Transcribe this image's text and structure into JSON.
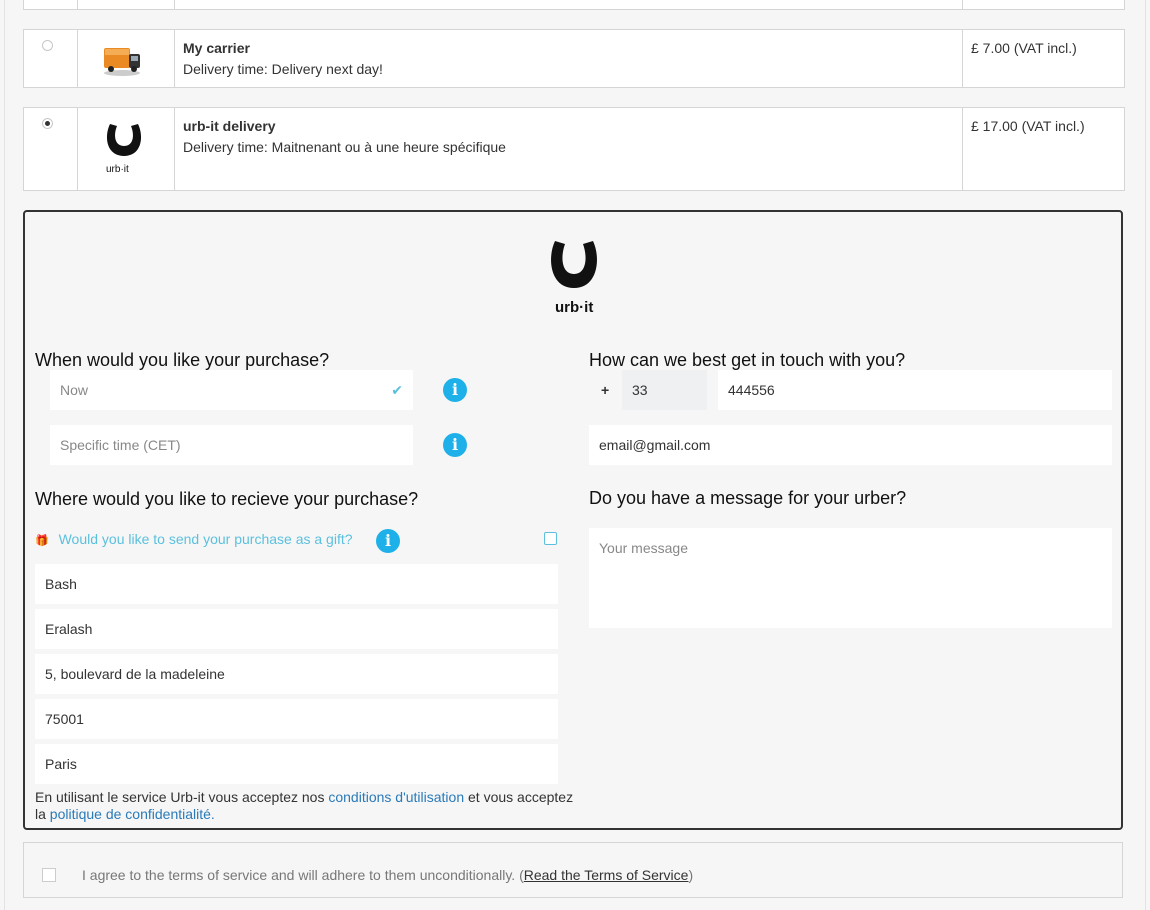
{
  "carriers": [
    {
      "name": "My carrier",
      "delay": "Delivery time: Delivery next day!",
      "price": "£ 7.00 (VAT incl.)",
      "logo": "truck-icon",
      "selected": false
    },
    {
      "name": "urb-it delivery",
      "delay": "Delivery time: Maitnenant ou à une heure spécifique",
      "price": "£ 17.00 (VAT incl.)",
      "logo": "urbit-logo",
      "logo_text": "urb·it",
      "selected": true
    }
  ],
  "urbit": {
    "logo_text": "urb·it",
    "when_title": "When would you like your purchase?",
    "now_value": "Now",
    "specific_placeholder": "Specific time (CET)",
    "contact_title": "How can we best get in touch with you?",
    "phone_plus": "+",
    "phone_prefix": "33",
    "phone_number": "444556",
    "email": "email@gmail.com",
    "where_title": "Where would you like to recieve your purchase?",
    "gift_label": "Would you like to send your purchase as a gift?",
    "address_fields": [
      "Bash",
      "Eralash",
      "5, boulevard de la madeleine",
      "75001",
      "Paris"
    ],
    "message_title": "Do you have a message for your urber?",
    "message_placeholder": "Your message",
    "legal_pre": "En utilisant le service Urb-it vous acceptez nos ",
    "legal_link1": "conditions d'utilisation",
    "legal_mid": " et vous acceptez",
    "legal_line2_pre": "la ",
    "legal_link2": "politique de confidentialité.",
    "info_glyph": "i",
    "check_glyph": "✔",
    "gift_glyph": "🎁"
  },
  "terms": {
    "text": "I agree to the terms of service and will adhere to them unconditionally. (",
    "link": "Read the Terms of Service",
    "close": ")"
  },
  "colors": {
    "accent": "#5bc0de",
    "info": "#1eb0e8",
    "link": "#2a7ab8"
  }
}
